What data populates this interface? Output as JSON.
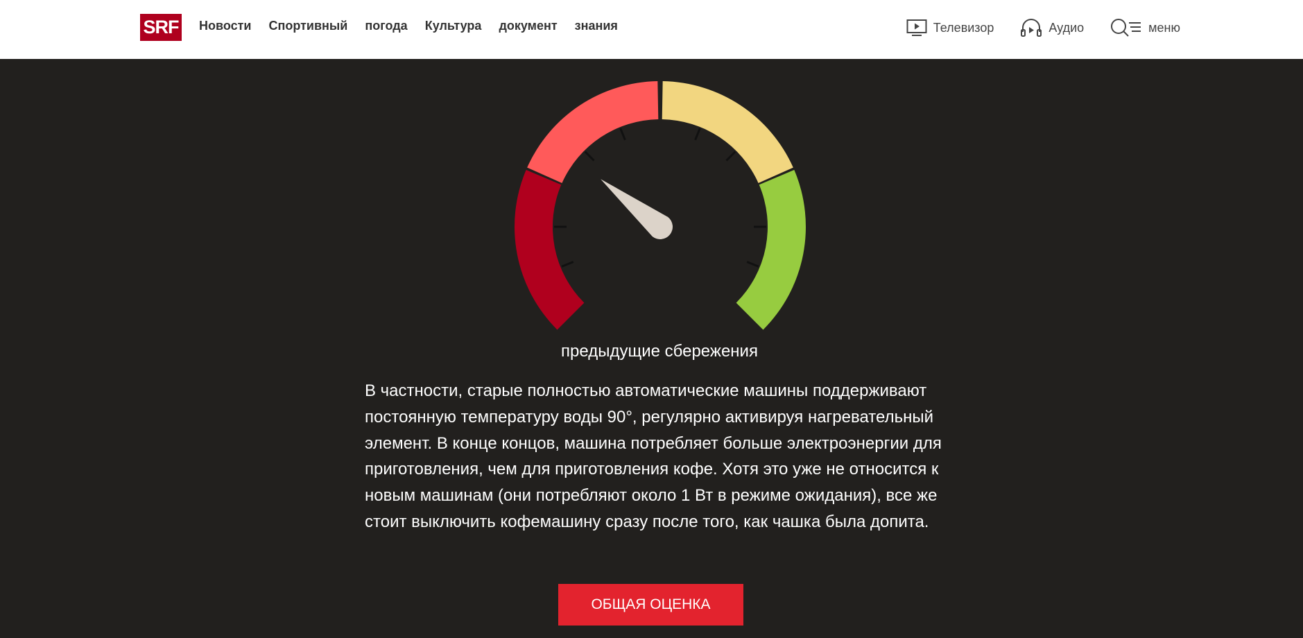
{
  "header": {
    "logo_text": "SRF",
    "nav": [
      "Новости",
      "Спортивный",
      "погода",
      "Культура",
      "документ",
      "знания"
    ],
    "tv_label": "Телевизор",
    "audio_label": "Аудио",
    "menu_label": "меню",
    "icons": {
      "tv": "tv-play-icon",
      "audio": "headphones-play-icon",
      "menu": "search-menu-icon"
    }
  },
  "gauge": {
    "label": "предыдущие сбережения",
    "level": 0.31,
    "colors": {
      "dark_red": "#b0001e",
      "light_red": "#ff5a5a",
      "yellow": "#f2d680",
      "green": "#97cc40",
      "needle": "#dcd3c9"
    }
  },
  "article": {
    "text": "В частности, старые полностью автоматические машины поддерживают постоянную температуру воды 90°, регулярно активируя нагревательный элемент. В конце концов, машина потребляет больше электроэнергии для приготовления, чем для приготовления кофе. Хотя это уже не относится к новым машинам (они потребляют около 1 Вт в режиме ожидания), все же стоит выключить кофемашину сразу после того, как чашка была допита."
  },
  "cta": {
    "label": "ОБЩАЯ ОЦЕНКА",
    "color": "#e3232e"
  }
}
